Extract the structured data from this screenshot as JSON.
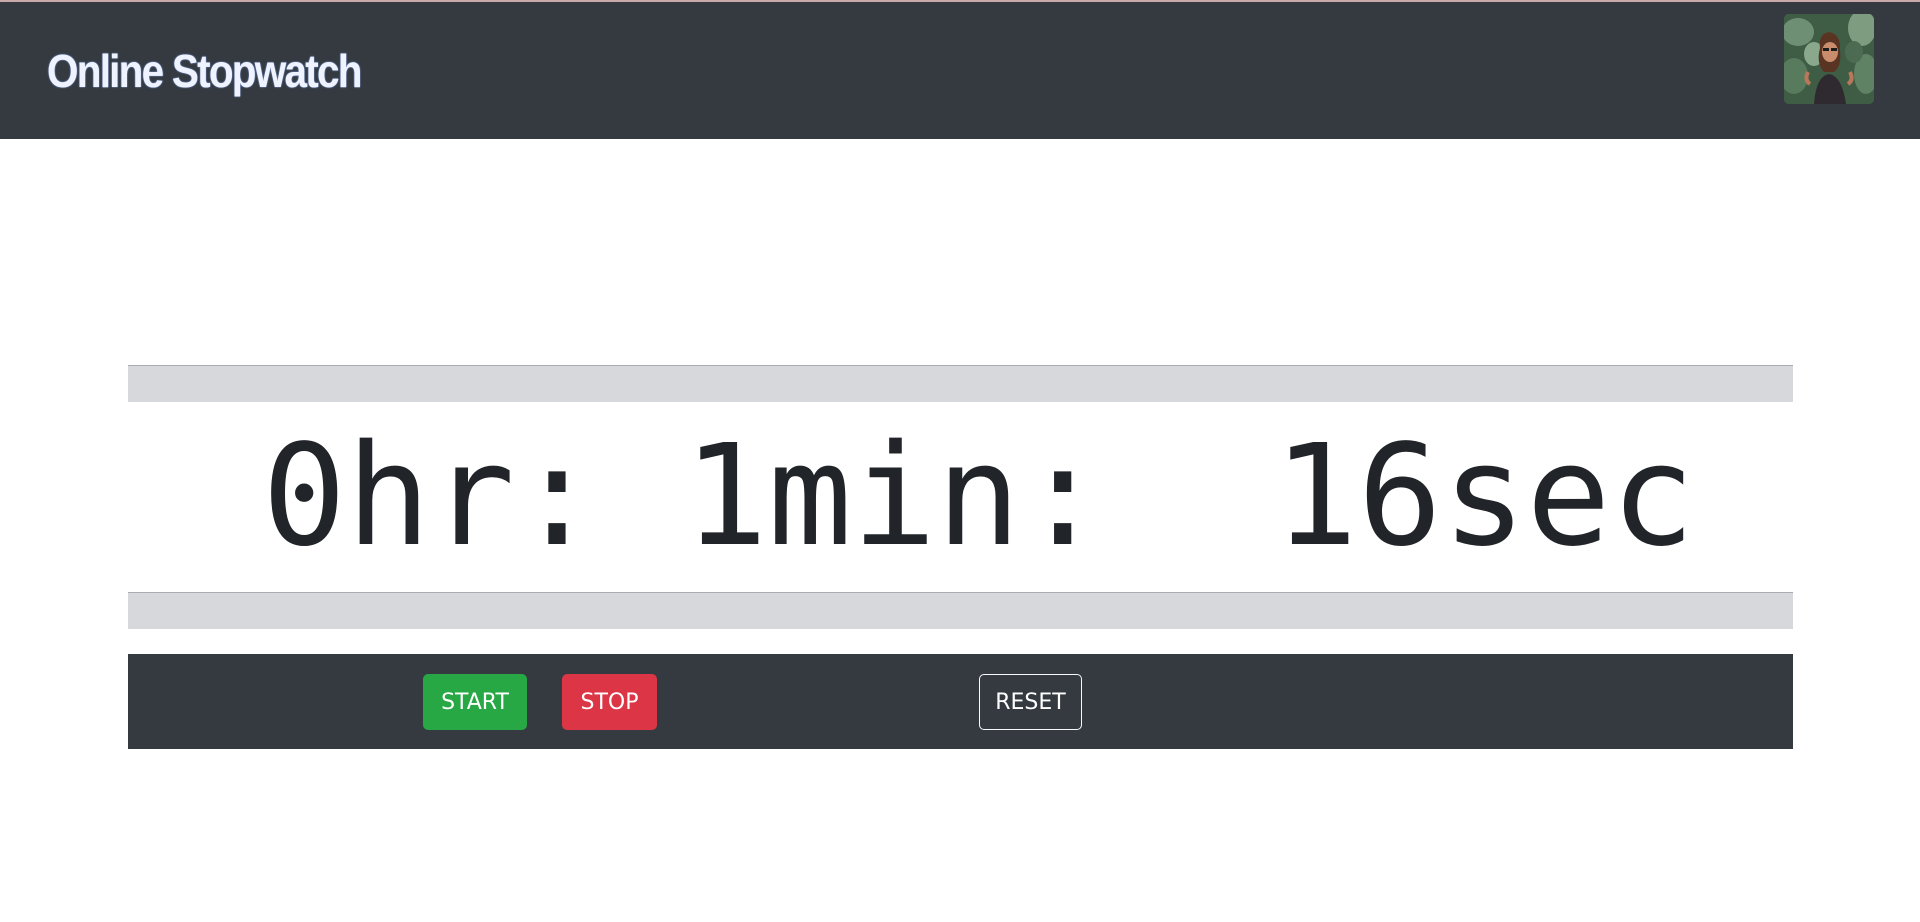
{
  "header": {
    "title": "Online Stopwatch",
    "avatar_icon": "user-avatar-photo"
  },
  "stopwatch": {
    "hours": 0,
    "minutes": 1,
    "seconds": 16,
    "display_text": "0hr: 1min:  16sec"
  },
  "controls": {
    "start_label": "START",
    "stop_label": "STOP",
    "reset_label": "RESET"
  },
  "colors": {
    "navbar": "#343a40",
    "start": "#28a745",
    "stop": "#dc3545",
    "band": "#d6d8dc"
  }
}
